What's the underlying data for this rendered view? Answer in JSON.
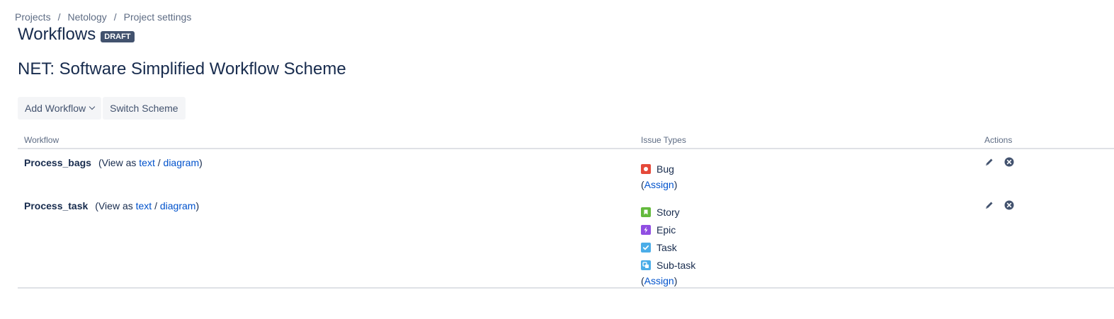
{
  "breadcrumb": {
    "items": [
      "Projects",
      "Netology",
      "Project settings"
    ],
    "separator": "/"
  },
  "header": {
    "title": "Workflows",
    "badge": "DRAFT"
  },
  "scheme": {
    "title": "NET: Software Simplified Workflow Scheme"
  },
  "toolbar": {
    "add_workflow_label": "Add Workflow",
    "switch_scheme_label": "Switch Scheme"
  },
  "table": {
    "columns": [
      "Workflow",
      "Issue Types",
      "Actions"
    ],
    "view_as_prefix": "(View as",
    "text_link": "text",
    "slash": "/",
    "diagram_link": "diagram",
    "close_paren": ")",
    "assign_open": "(",
    "assign_label": "Assign",
    "assign_close": ")",
    "rows": [
      {
        "name": "Process_bags",
        "issue_types": [
          {
            "label": "Bug",
            "icon": "bug-icon",
            "color": "#e5493a"
          }
        ]
      },
      {
        "name": "Process_task",
        "issue_types": [
          {
            "label": "Story",
            "icon": "story-icon",
            "color": "#63ba3c"
          },
          {
            "label": "Epic",
            "icon": "epic-icon",
            "color": "#904ee2"
          },
          {
            "label": "Task",
            "icon": "task-icon",
            "color": "#4bade8"
          },
          {
            "label": "Sub-task",
            "icon": "subtask-icon",
            "color": "#4bade8"
          }
        ]
      }
    ]
  },
  "colors": {
    "link": "#0052cc",
    "text": "#172b4d",
    "muted": "#5e6c84",
    "badge_bg": "#42526e",
    "button_bg": "#f4f5f7"
  }
}
